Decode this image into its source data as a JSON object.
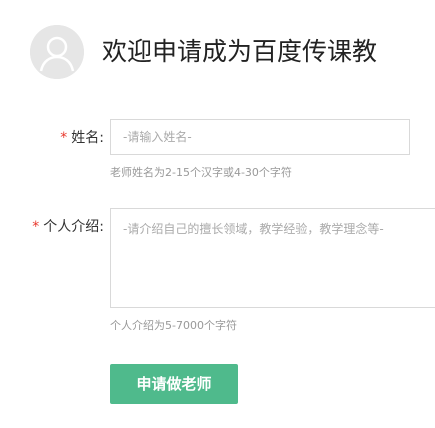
{
  "header": {
    "title": "欢迎申请成为百度传课教"
  },
  "form": {
    "name": {
      "label": "姓名:",
      "required_mark": "*",
      "placeholder": "-请输入姓名-",
      "hint": "老师姓名为2-15个汉字或4-30个字符"
    },
    "intro": {
      "label": "个人介绍:",
      "required_mark": "*",
      "placeholder": "-请介绍自己的擅长领域，教学经验，教学理念等-",
      "hint": "个人介绍为5-7000个字符"
    },
    "submit_label": "申请做老师"
  },
  "colors": {
    "accent": "#4fba8c",
    "required": "#e8372b",
    "avatar_bg": "#e6e6e6"
  },
  "icons": {
    "avatar": "user-silhouette-icon"
  }
}
